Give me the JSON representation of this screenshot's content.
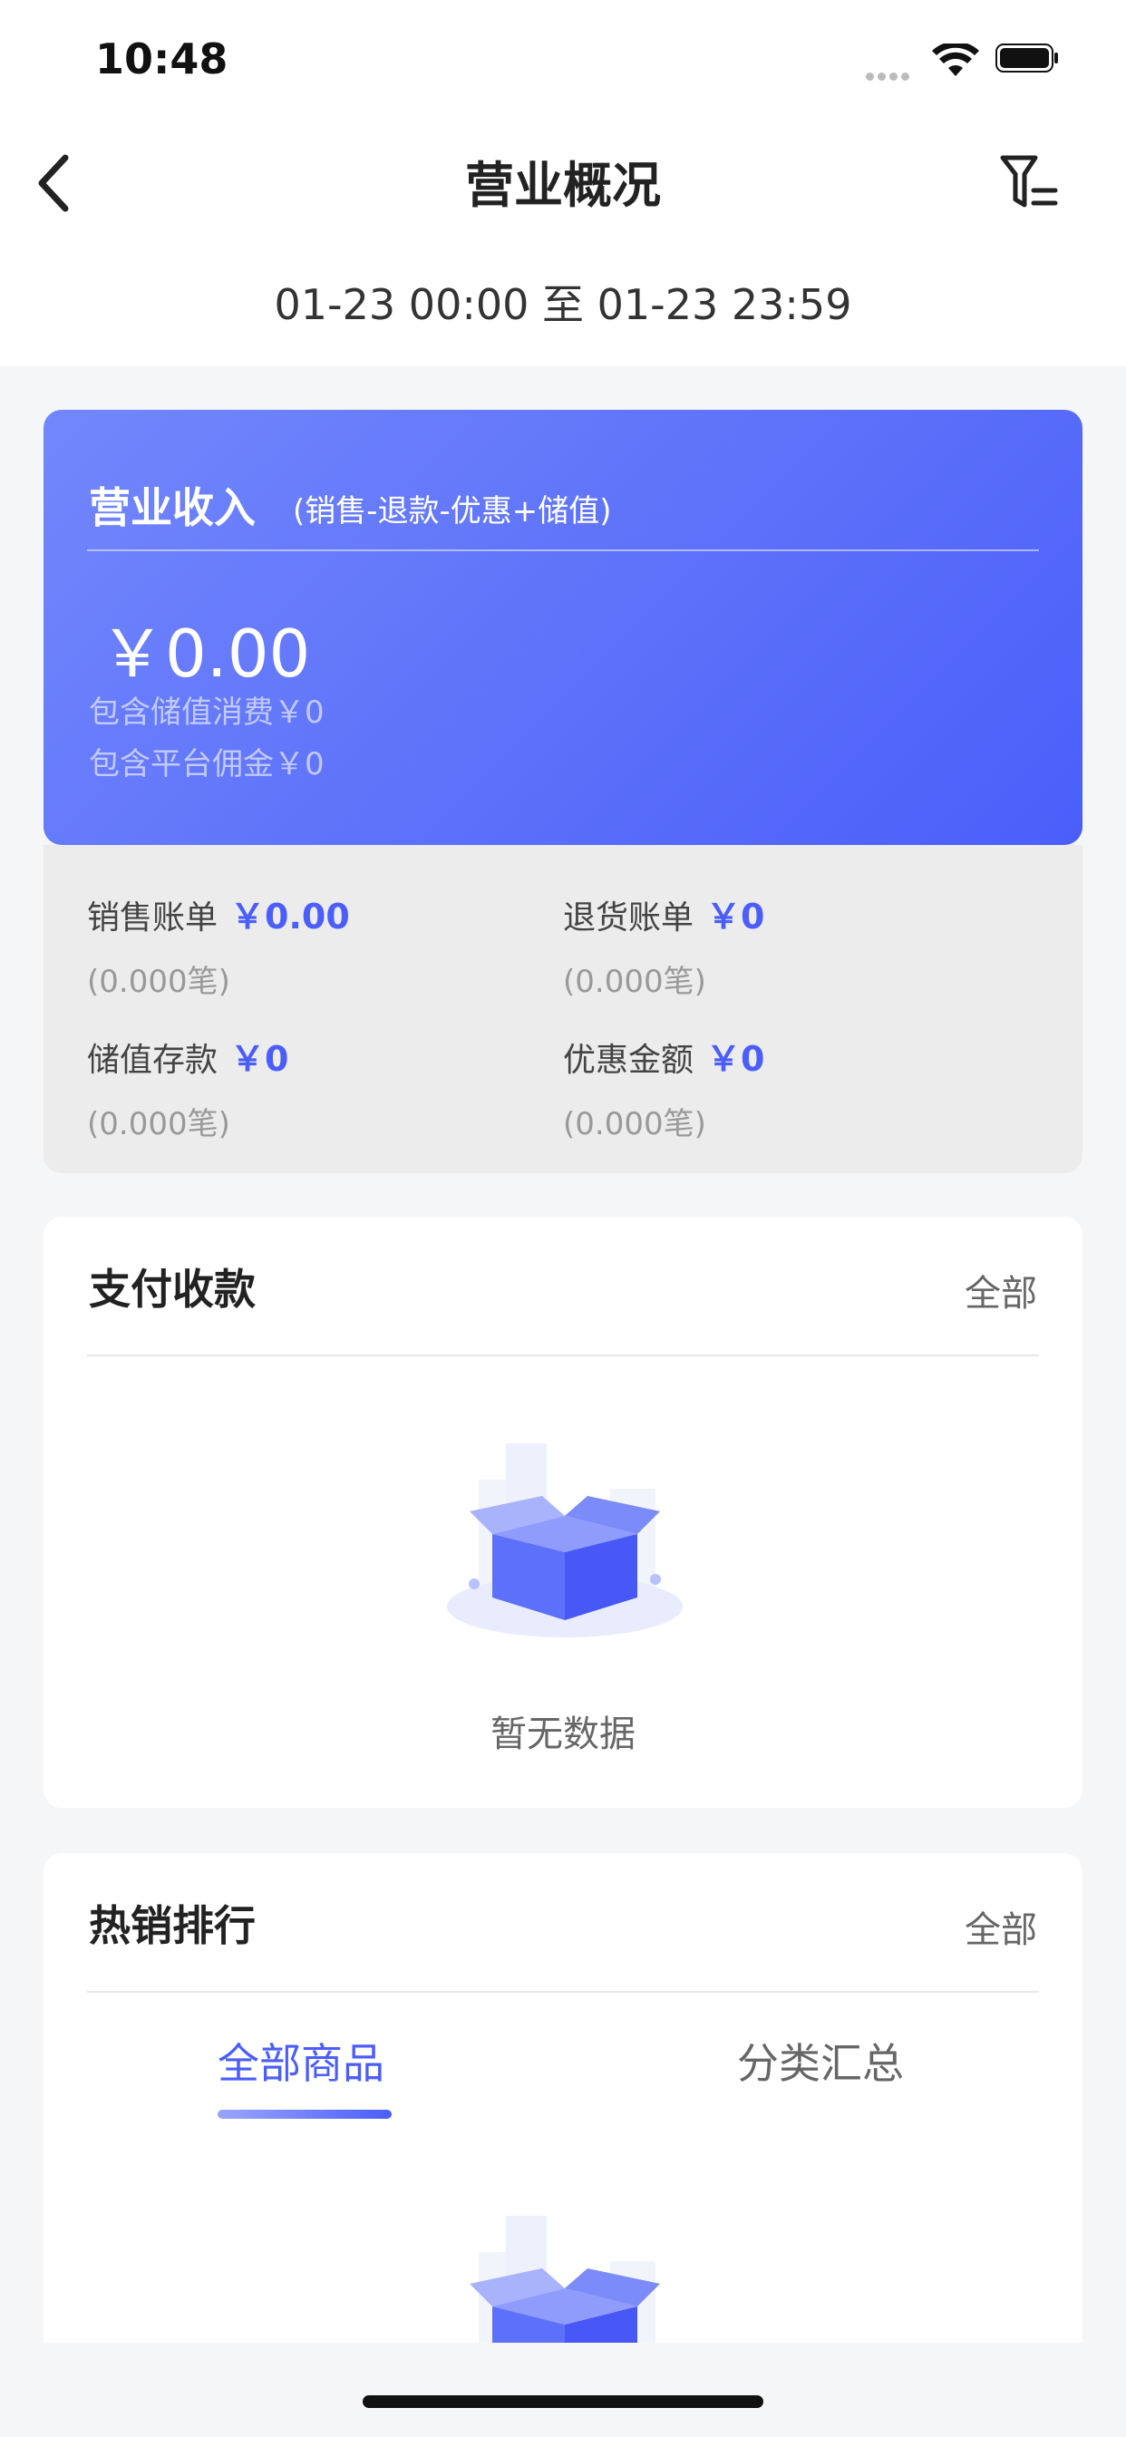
{
  "status_bar": {
    "time": "10:48"
  },
  "nav": {
    "title": "营业概况",
    "back_icon": "chevron-left-icon",
    "filter_icon": "filter-icon"
  },
  "date_range": "01-23 00:00 至 01-23 23:59",
  "revenue": {
    "title": "营业收入",
    "formula": "(销售-退款-优惠+储值)",
    "amount": "￥0.00",
    "note_stored": "包含储值消费￥0",
    "note_platform": "包含平台佣金￥0"
  },
  "stats": [
    {
      "label": "销售账单",
      "value": "￥0.00",
      "count": "(0.000笔)"
    },
    {
      "label": "退货账单",
      "value": "￥0",
      "count": "(0.000笔)"
    },
    {
      "label": "储值存款",
      "value": "￥0",
      "count": "(0.000笔)"
    },
    {
      "label": "优惠金额",
      "value": "￥0",
      "count": "(0.000笔)"
    }
  ],
  "payment": {
    "title": "支付收款",
    "all_label": "全部",
    "empty_text": "暂无数据"
  },
  "hot": {
    "title": "热销排行",
    "all_label": "全部",
    "tabs": [
      {
        "label": "全部商品"
      },
      {
        "label": "分类汇总"
      }
    ]
  },
  "colors": {
    "accent": "#4b5efa",
    "accent_light": "#7287fb"
  }
}
